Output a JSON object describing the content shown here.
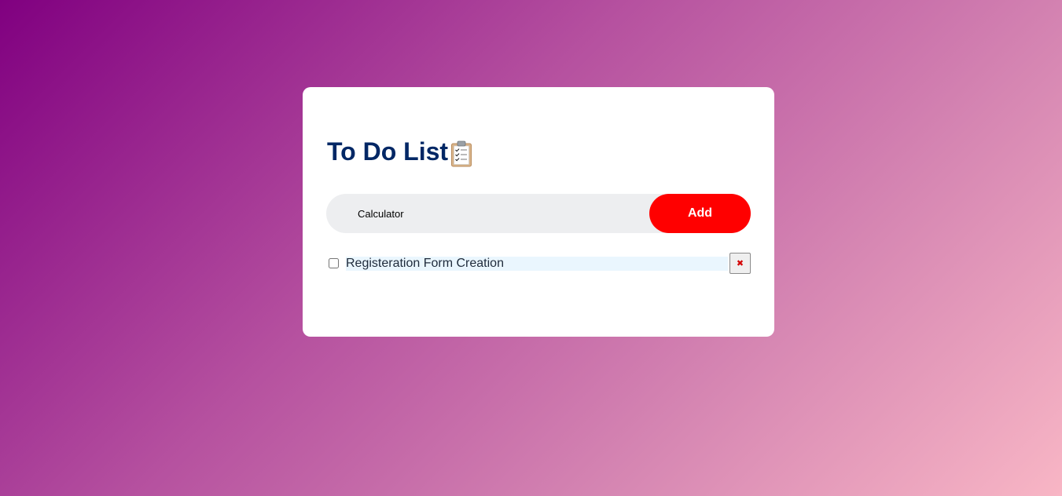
{
  "app": {
    "title": "To Do List",
    "title_icon": "clipboard-checklist-icon"
  },
  "input": {
    "value": "Calculator",
    "placeholder": ""
  },
  "add_button": {
    "label": "Add"
  },
  "tasks": [
    {
      "label": "Registeration Form Creation",
      "checked": false,
      "delete_label": "✖",
      "delete_icon": "close-icon"
    }
  ],
  "colors": {
    "title": "#002765",
    "add_button": "#ff0000",
    "input_bg": "#edeef0",
    "task_bg": "#eaf6fe",
    "gradient_start": "#800080",
    "gradient_end": "#f8b6c5"
  }
}
